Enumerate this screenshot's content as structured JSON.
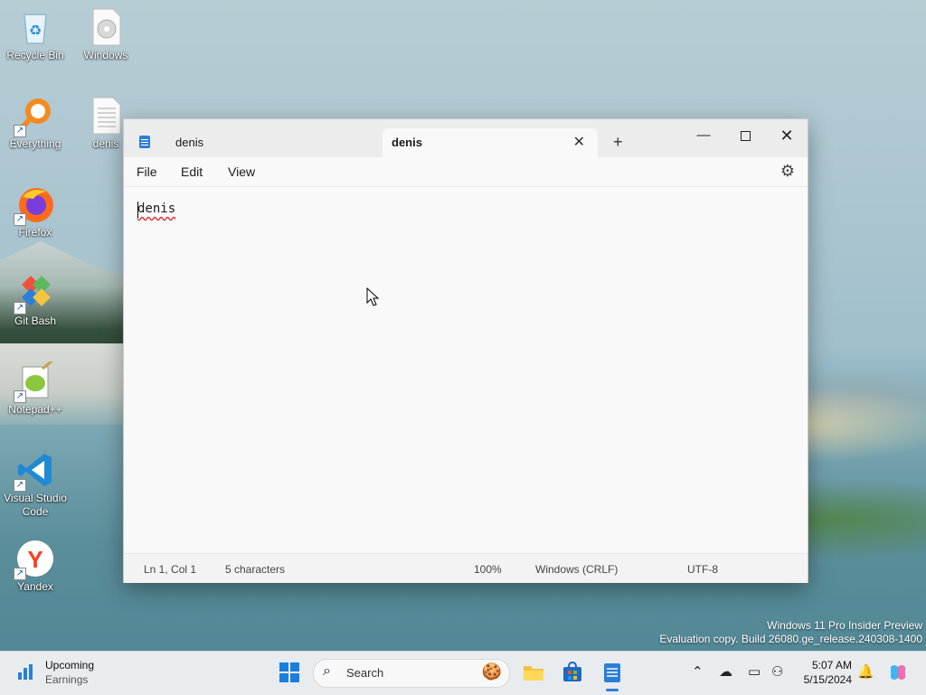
{
  "desktop": {
    "icons": [
      {
        "label": "Recycle Bin"
      },
      {
        "label": "Windows"
      },
      {
        "label": "Everything"
      },
      {
        "label": "denis"
      },
      {
        "label": "Firefox"
      },
      {
        "label": "Git Bash"
      },
      {
        "label": "Notepad++"
      },
      {
        "label": "Visual Studio Code"
      },
      {
        "label": "Yandex"
      }
    ],
    "watermark": {
      "line1": "Windows 11 Pro Insider Preview",
      "line2": "Evaluation copy. Build 26080.ge_release.240308-1400"
    }
  },
  "notepad": {
    "tabs": [
      {
        "label": "denis",
        "active": false
      },
      {
        "label": "denis",
        "active": true,
        "close_glyph": "✕"
      }
    ],
    "new_tab_glyph": "+",
    "window_controls": {
      "minimize": "—",
      "close": "✕"
    },
    "menu": {
      "file": "File",
      "edit": "Edit",
      "view": "View"
    },
    "settings_icon": "gear-icon",
    "content": "denis",
    "status": {
      "position": "Ln 1, Col 1",
      "characters": "5 characters",
      "zoom": "100%",
      "line_ending": "Windows (CRLF)",
      "encoding": "UTF-8"
    }
  },
  "taskbar": {
    "widget": {
      "title": "Upcoming",
      "subtitle": "Earnings"
    },
    "search_placeholder": "Search",
    "clock": {
      "time": "5:07 AM",
      "date": "5/15/2024"
    },
    "accent": "#2b7fd6"
  }
}
